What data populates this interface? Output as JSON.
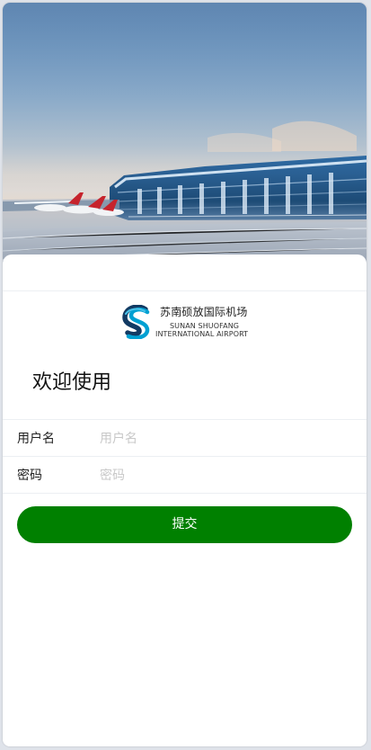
{
  "hero": {
    "image_semantic": "airport-terminal-photo"
  },
  "logo": {
    "chinese_name": "苏南硕放国际机场",
    "english_line1": "SUNAN SHUOFANG",
    "english_line2": "INTERNATIONAL AIRPORT"
  },
  "welcome": {
    "text": "欢迎使用"
  },
  "form": {
    "username": {
      "label": "用户名",
      "placeholder": "用户名",
      "value": ""
    },
    "password": {
      "label": "密码",
      "placeholder": "密码",
      "value": ""
    },
    "submit_label": "提交"
  },
  "colors": {
    "button": "#008000",
    "logo_blue": "#00a0d2",
    "logo_dark": "#123a63"
  }
}
